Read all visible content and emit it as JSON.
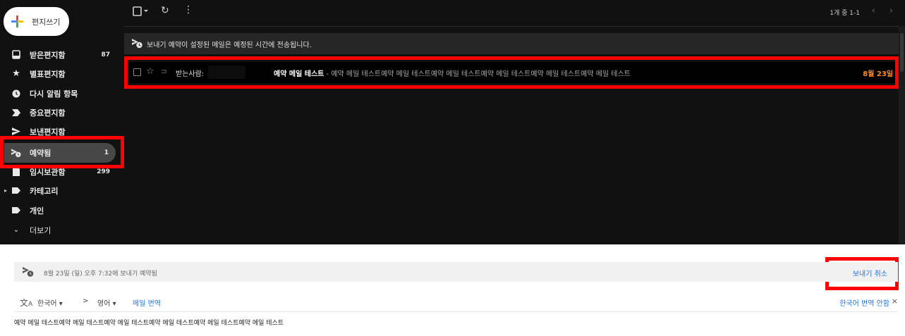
{
  "compose": {
    "label": "편지쓰기",
    "icon": "compose-plus-icon"
  },
  "sidebar": {
    "items": [
      {
        "label": "받은편지함",
        "count": "87",
        "icon": "inbox-icon"
      },
      {
        "label": "별표편지함",
        "count": "",
        "icon": "star-icon"
      },
      {
        "label": "다시 알림 항목",
        "count": "",
        "icon": "clock-icon"
      },
      {
        "label": "중요편지함",
        "count": "",
        "icon": "important-icon"
      },
      {
        "label": "보낸편지함",
        "count": "",
        "icon": "send-icon"
      },
      {
        "label": "예약됨",
        "count": "1",
        "icon": "scheduled-icon",
        "active": true
      },
      {
        "label": "임시보관함",
        "count": "299",
        "icon": "draft-icon"
      },
      {
        "label": "카테고리",
        "count": "",
        "icon": "label-icon"
      },
      {
        "label": "개인",
        "count": "",
        "icon": "label-icon"
      },
      {
        "label": "더보기",
        "count": "",
        "icon": "chevron-down-icon"
      }
    ]
  },
  "toolbar": {
    "pager": "1개 중 1-1",
    "icons": [
      "select-checkbox-icon",
      "refresh-icon",
      "more-vert-icon",
      "chevron-left-icon",
      "chevron-right-icon"
    ]
  },
  "banner": {
    "text": "보내기 예약이 설정된 메일은 예정된 시간에 전송됩니다."
  },
  "message_row": {
    "to_label": "받는사람:",
    "subject": "예약 메일 테스트",
    "snippet": " - 예약 메일 테스트예약 메일 테스트예약 메일 테스트예약 메일 테스트예약 메일 테스트예약 메일 테스트",
    "date": "8월 23일"
  },
  "detail": {
    "scheduled_text": "8월 23일 (일) 오후 7:32에 보내기 예약됨",
    "cancel_label": "보내기 취소"
  },
  "translate": {
    "source_lang": "한국어",
    "arrow": ">",
    "target_lang": "영어",
    "translate_link": "메일 번역",
    "never_translate": "한국어 번역 안함",
    "close": "×"
  },
  "body": {
    "text": "예약 메일 테스트예약 메일 테스트예약 메일 테스트예약 메일 테스트예약 메일 테스트예약 메일 테스트"
  },
  "colors": {
    "dark_bg": "#111111",
    "active_nav": "#474747",
    "highlight_red": "#ff0000",
    "date_orange": "#ff8a2a",
    "link_blue": "#1a73e8"
  }
}
